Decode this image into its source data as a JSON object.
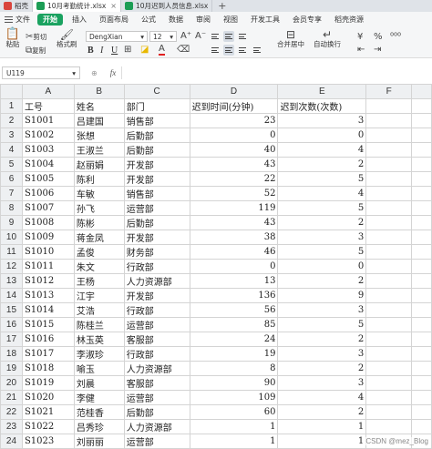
{
  "tabs": [
    {
      "label": "稻壳",
      "icon": "daoke-logo-icon",
      "active": false,
      "color": "#d9443b"
    },
    {
      "label": "10月考勤统计.xlsx",
      "icon": "sheet-file-icon",
      "active": true,
      "color": "#1c9d55"
    },
    {
      "label": "10月迟到人员信息.xlsx",
      "icon": "sheet-file-icon",
      "active": false,
      "color": "#1c9d55"
    }
  ],
  "tab_add": "+",
  "menu": {
    "file_label": "文件",
    "start_label": "开始",
    "items": [
      "插入",
      "页面布局",
      "公式",
      "数据",
      "审阅",
      "视图",
      "开发工具",
      "会员专享",
      "稻壳资源"
    ]
  },
  "toolbar": {
    "paste": "粘贴",
    "cut": "剪切",
    "copy": "复制",
    "format_painter": "格式刷",
    "font_name": "DengXian",
    "font_size": "12",
    "merge_center": "合并居中",
    "wrap": "自动换行"
  },
  "formula_bar": {
    "cell_ref": "U119",
    "fx": "fx",
    "value": ""
  },
  "sheet": {
    "columns": [
      "A",
      "B",
      "C",
      "D",
      "E",
      "F"
    ],
    "header_row": [
      "工号",
      "姓名",
      "部门",
      "迟到时间(分钟)",
      "迟到次数(次数)",
      ""
    ],
    "rows": [
      {
        "n": "2",
        "id": "S1001",
        "name": "吕建国",
        "dept": "销售部",
        "minutes": "23",
        "times": "3"
      },
      {
        "n": "3",
        "id": "S1002",
        "name": "张想",
        "dept": "后勤部",
        "minutes": "0",
        "times": "0"
      },
      {
        "n": "4",
        "id": "S1003",
        "name": "王淑兰",
        "dept": "后勤部",
        "minutes": "40",
        "times": "4"
      },
      {
        "n": "5",
        "id": "S1004",
        "name": "赵丽娟",
        "dept": "开发部",
        "minutes": "43",
        "times": "2"
      },
      {
        "n": "6",
        "id": "S1005",
        "name": "陈利",
        "dept": "开发部",
        "minutes": "22",
        "times": "5"
      },
      {
        "n": "7",
        "id": "S1006",
        "name": "车敏",
        "dept": "销售部",
        "minutes": "52",
        "times": "4"
      },
      {
        "n": "8",
        "id": "S1007",
        "name": "孙飞",
        "dept": "运营部",
        "minutes": "119",
        "times": "5"
      },
      {
        "n": "9",
        "id": "S1008",
        "name": "陈彬",
        "dept": "后勤部",
        "minutes": "43",
        "times": "2"
      },
      {
        "n": "10",
        "id": "S1009",
        "name": "蒋金凤",
        "dept": "开发部",
        "minutes": "38",
        "times": "3"
      },
      {
        "n": "11",
        "id": "S1010",
        "name": "孟俊",
        "dept": "财务部",
        "minutes": "46",
        "times": "5"
      },
      {
        "n": "12",
        "id": "S1011",
        "name": "朱文",
        "dept": "行政部",
        "minutes": "0",
        "times": "0"
      },
      {
        "n": "13",
        "id": "S1012",
        "name": "王杨",
        "dept": "人力资源部",
        "minutes": "13",
        "times": "2"
      },
      {
        "n": "14",
        "id": "S1013",
        "name": "江宇",
        "dept": "开发部",
        "minutes": "136",
        "times": "9"
      },
      {
        "n": "15",
        "id": "S1014",
        "name": "艾浩",
        "dept": "行政部",
        "minutes": "56",
        "times": "3"
      },
      {
        "n": "16",
        "id": "S1015",
        "name": "陈桂兰",
        "dept": "运营部",
        "minutes": "85",
        "times": "5"
      },
      {
        "n": "17",
        "id": "S1016",
        "name": "林玉英",
        "dept": "客服部",
        "minutes": "24",
        "times": "2"
      },
      {
        "n": "18",
        "id": "S1017",
        "name": "李淑珍",
        "dept": "行政部",
        "minutes": "19",
        "times": "3"
      },
      {
        "n": "19",
        "id": "S1018",
        "name": "喻玉",
        "dept": "人力资源部",
        "minutes": "8",
        "times": "2"
      },
      {
        "n": "20",
        "id": "S1019",
        "name": "刘晨",
        "dept": "客服部",
        "minutes": "90",
        "times": "3"
      },
      {
        "n": "21",
        "id": "S1020",
        "name": "李健",
        "dept": "运营部",
        "minutes": "109",
        "times": "4"
      },
      {
        "n": "22",
        "id": "S1021",
        "name": "范桂香",
        "dept": "后勤部",
        "minutes": "60",
        "times": "2"
      },
      {
        "n": "23",
        "id": "S1022",
        "name": "吕秀珍",
        "dept": "人力资源部",
        "minutes": "1",
        "times": "1"
      },
      {
        "n": "24",
        "id": "S1023",
        "name": "刘丽丽",
        "dept": "运营部",
        "minutes": "1",
        "times": "1"
      },
      {
        "n": "25",
        "id": "S1024",
        "name": "张芳",
        "dept": "销售部",
        "minutes": "",
        "times": ""
      }
    ]
  },
  "watermark": "CSDN @mez_Blog"
}
